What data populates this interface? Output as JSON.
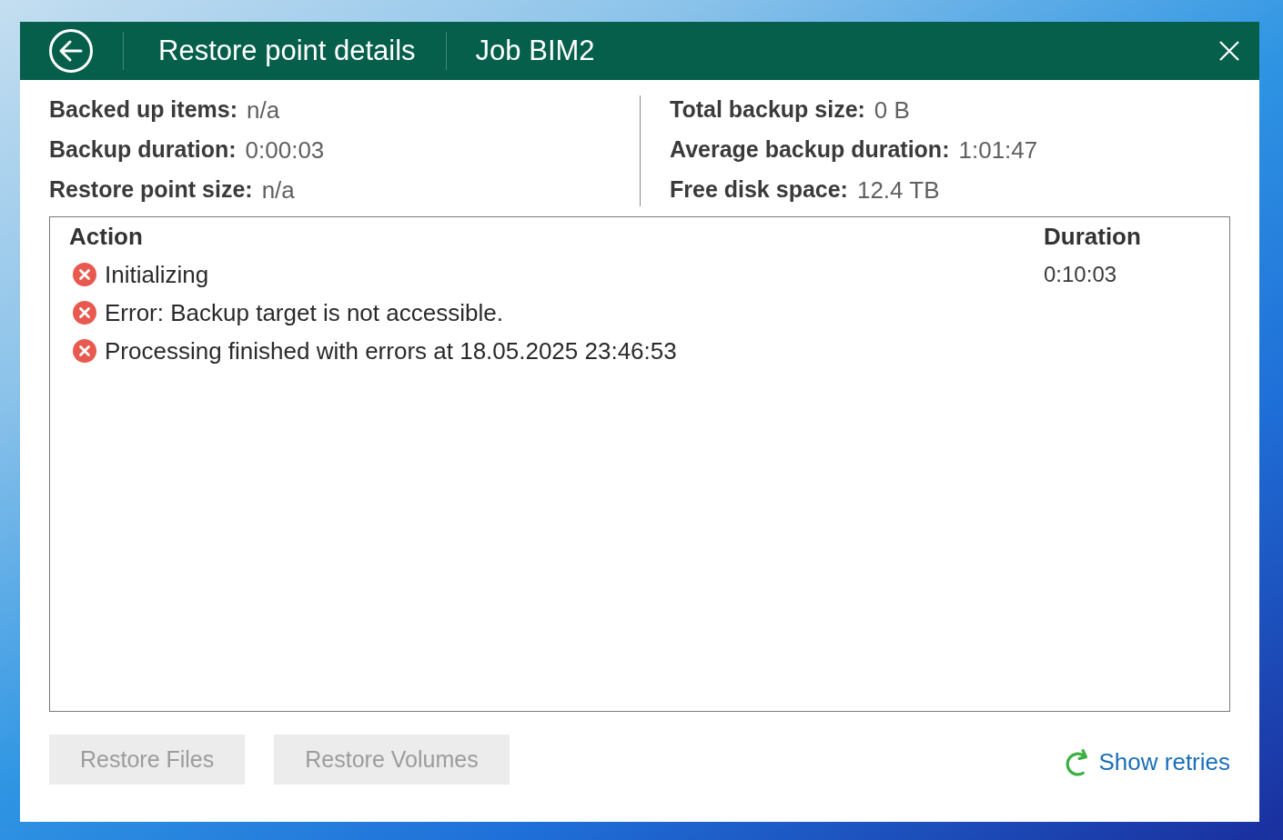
{
  "dialog": {
    "title": "Restore point details",
    "subtitle": "Job BIM2"
  },
  "summary": {
    "left": [
      {
        "label": "Backed up items:",
        "value": "n/a"
      },
      {
        "label": "Backup duration:",
        "value": "0:00:03"
      },
      {
        "label": "Restore point size:",
        "value": "n/a"
      }
    ],
    "right": [
      {
        "label": "Total backup size:",
        "value": "0 B"
      },
      {
        "label": "Average backup duration:",
        "value": "1:01:47"
      },
      {
        "label": "Free disk space:",
        "value": "12.4 TB"
      }
    ]
  },
  "table": {
    "columns": [
      "Action",
      "Duration"
    ],
    "rows": [
      {
        "failed": true,
        "action": "Initializing",
        "duration": "0:10:03"
      },
      {
        "failed": true,
        "action": "Error: Backup target is not accessible."
      },
      {
        "failed": true,
        "action": "Processing finished with errors at 18.05.2025 23:46:53"
      }
    ]
  },
  "buttons": [
    {
      "label": "Restore Files",
      "disabled": true
    },
    {
      "label": "Restore Volumes",
      "disabled": true
    }
  ],
  "link": {
    "label": "Show retries"
  }
}
